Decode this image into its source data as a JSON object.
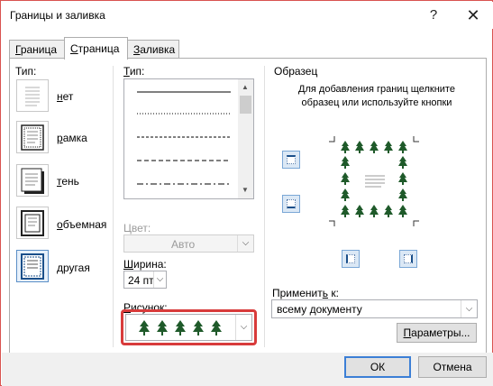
{
  "window": {
    "title": "Границы и заливка",
    "help": "?",
    "close": "✕"
  },
  "tabs": [
    {
      "label": "Граница",
      "underline": "Г",
      "rest": "раница",
      "active": false
    },
    {
      "label": "Страница",
      "underline": "С",
      "rest": "траница",
      "active": true
    },
    {
      "label": "Заливка",
      "underline": "З",
      "rest": "аливка",
      "active": false
    }
  ],
  "type_section": {
    "heading": "Тип:",
    "presets": [
      {
        "label": "нет",
        "u": "н",
        "rest": "ет"
      },
      {
        "label": "рамка",
        "u": "р",
        "rest": "амка"
      },
      {
        "label": "тень",
        "u": "т",
        "rest": "ень"
      },
      {
        "label": "объемная",
        "u": "о",
        "rest": "бъемная"
      },
      {
        "label": "другая",
        "u": "д",
        "rest": "ругая"
      }
    ]
  },
  "style_section": {
    "heading": "Тип:",
    "line_styles": [
      "solid",
      "dotted",
      "dashed-short",
      "dashed",
      "dash-dot"
    ],
    "color_label": "Цвет:",
    "color_value": "Авто",
    "width_label": "Ширина:",
    "width_value": "24 пт",
    "art_label": "Рисунок:",
    "art_value": "trees"
  },
  "preview": {
    "heading": "Образец",
    "instructions": "Для добавления границ щелкните образец или используйте кнопки",
    "apply_label": "Применить к:",
    "apply_value": "всему документу",
    "options_button": "Параметры..."
  },
  "footer": {
    "ok": "ОК",
    "cancel": "Отмена"
  },
  "colors": {
    "accent": "#3c7fd6",
    "highlight": "#d83b3b",
    "tree": "#1f5a2a"
  }
}
